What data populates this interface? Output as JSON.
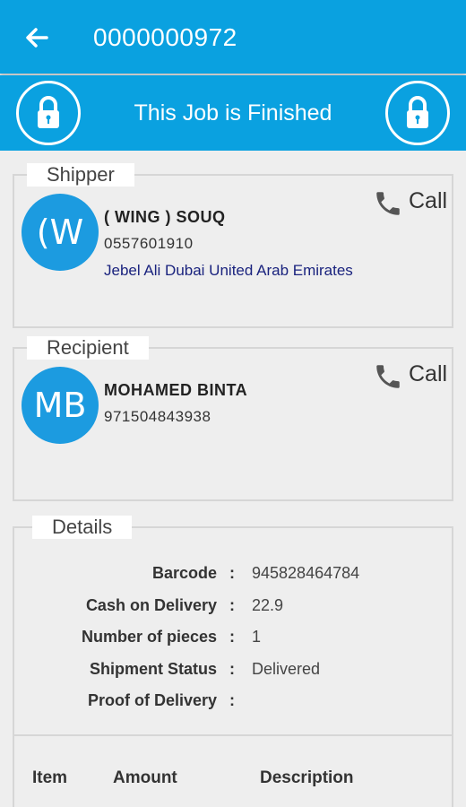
{
  "appbar": {
    "title": "0000000972"
  },
  "banner": {
    "text": "This Job is Finished"
  },
  "shipper": {
    "legend": "Shipper",
    "initials": "(W",
    "name": "( WING ) SOUQ",
    "phone": "0557601910",
    "address": "Jebel Ali Dubai United Arab Emirates",
    "call_label": "Call"
  },
  "recipient": {
    "legend": "Recipient",
    "initials": "MB",
    "name": "MOHAMED BINTA",
    "phone": "971504843938",
    "call_label": "Call"
  },
  "details": {
    "legend": "Details",
    "separator": ":",
    "rows": [
      {
        "label": "Barcode",
        "value": "945828464784"
      },
      {
        "label": "Cash on Delivery",
        "value": "22.9"
      },
      {
        "label": "Number of pieces",
        "value": "1"
      },
      {
        "label": "Shipment Status",
        "value": "Delivered"
      },
      {
        "label": "Proof of Delivery",
        "value": ""
      }
    ],
    "table_headers": {
      "item": "Item",
      "amount": "Amount",
      "description": "Description"
    }
  },
  "colors": {
    "primary": "#0aa1e0",
    "avatar": "#1c9be0",
    "address": "#1a237e"
  },
  "icons": {
    "back": "arrow-left-icon",
    "lock": "lock-icon",
    "phone": "phone-icon"
  }
}
